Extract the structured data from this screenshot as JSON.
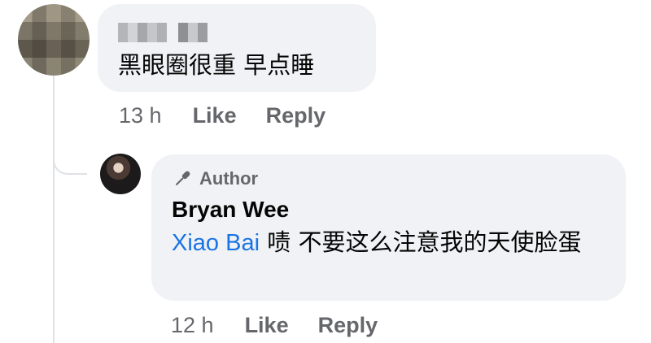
{
  "comment": {
    "author_name": "Xiao Bai",
    "text": "黑眼圈很重 早点睡",
    "time": "13 h",
    "like_label": "Like",
    "reply_label": "Reply"
  },
  "reply": {
    "badge_label": "Author",
    "author_name": "Bryan Wee",
    "mention": "Xiao Bai",
    "text": " 啧 不要这么注意我的天使脸蛋",
    "time": "12 h",
    "like_label": "Like",
    "reply_label": "Reply"
  },
  "colors": {
    "bubble": "#f0f2f5",
    "meta_text": "#65676b",
    "mention": "#1b74e4",
    "thread_line": "#dfe1e5"
  },
  "icons": {
    "author_badge": "microphone-icon"
  }
}
